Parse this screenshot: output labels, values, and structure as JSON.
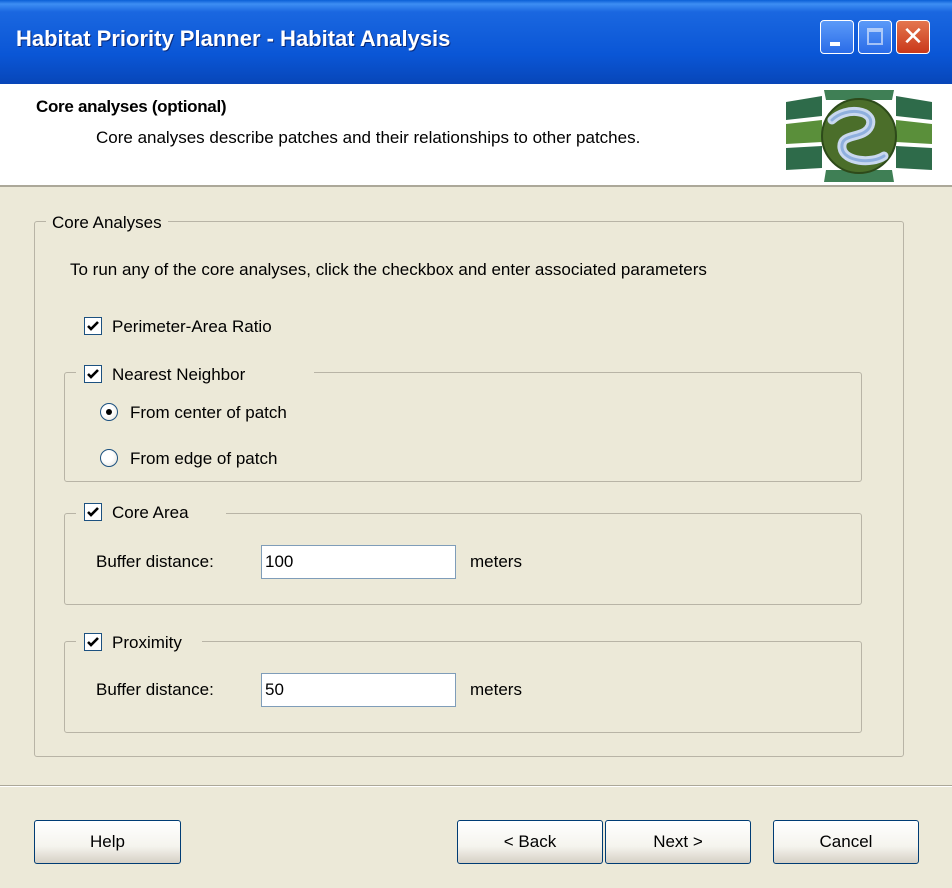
{
  "window": {
    "title": "Habitat Priority Planner - Habitat Analysis"
  },
  "header": {
    "title": "Core analyses (optional)",
    "description": "Core analyses describe patches and their relationships to other patches."
  },
  "core_analyses": {
    "group_label": "Core Analyses",
    "instruction": "To run any of the core analyses, click the checkbox and enter associated parameters",
    "perimeter_area": {
      "label": "Perimeter-Area Ratio",
      "checked": true
    },
    "nearest_neighbor": {
      "label": "Nearest Neighbor",
      "checked": true,
      "options": [
        {
          "label": "From center of patch",
          "selected": true
        },
        {
          "label": "From edge of patch",
          "selected": false
        }
      ]
    },
    "core_area": {
      "label": "Core Area",
      "checked": true,
      "buffer_label": "Buffer distance:",
      "buffer_value": "100",
      "unit": "meters"
    },
    "proximity": {
      "label": "Proximity",
      "checked": true,
      "buffer_label": "Buffer distance:",
      "buffer_value": "50",
      "unit": "meters"
    }
  },
  "buttons": {
    "help": "Help",
    "back": "< Back",
    "next": "Next >",
    "cancel": "Cancel"
  },
  "icons": {
    "minimize": "minimize-icon",
    "maximize": "maximize-icon",
    "close": "close-icon",
    "logo": "habitat-planner-logo",
    "check": "checkmark-icon"
  }
}
